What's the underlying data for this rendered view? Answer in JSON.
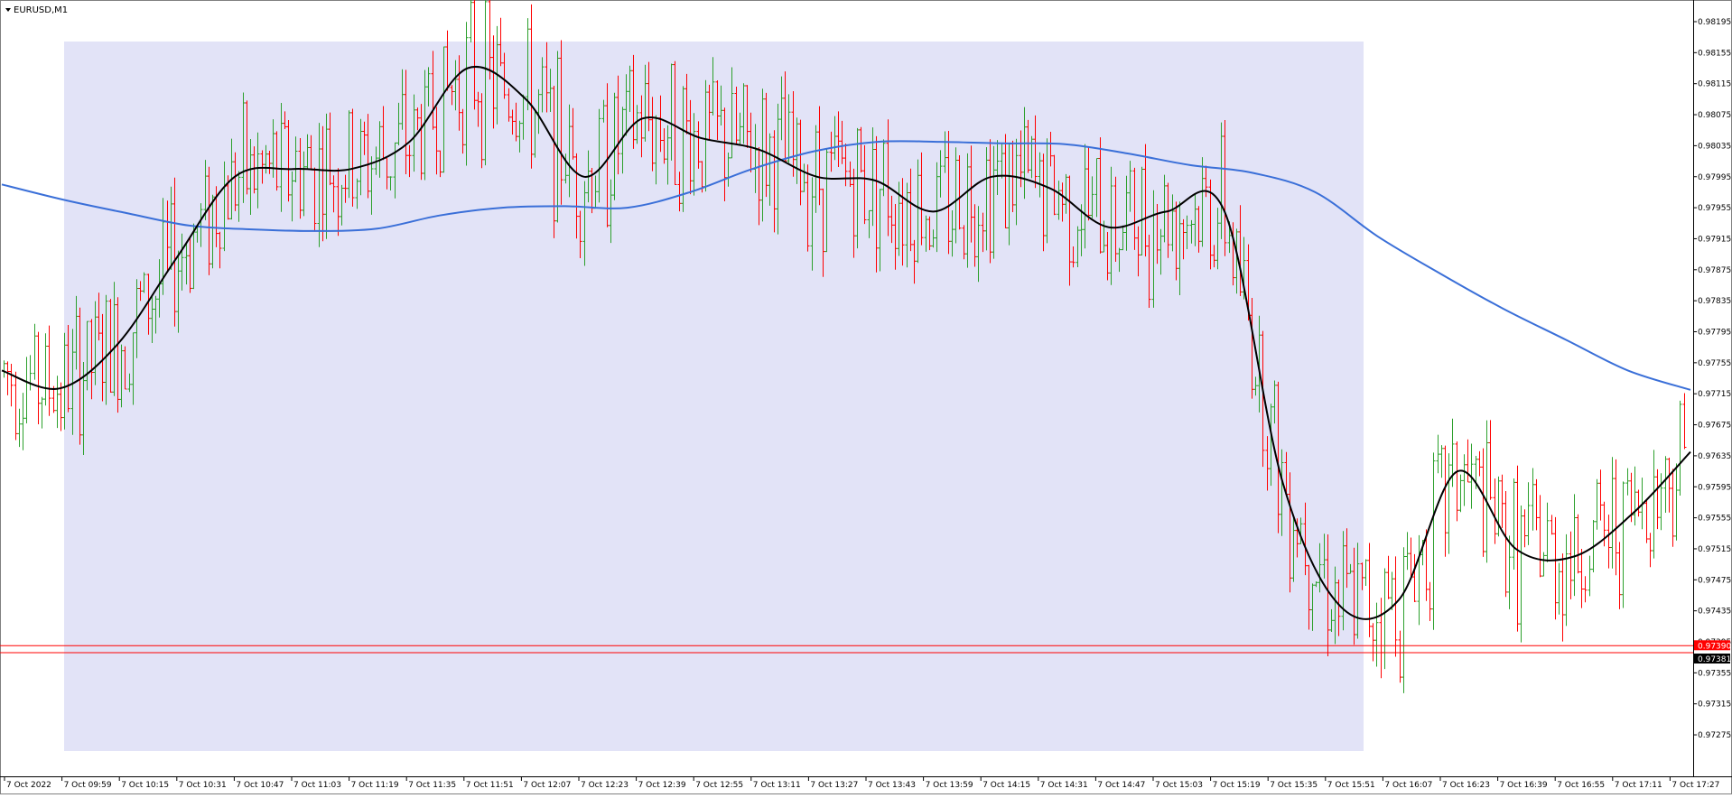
{
  "window": {
    "symbol_label": "EURUSD,M1",
    "menu_arrow_icon": "triangle-down-icon"
  },
  "colors": {
    "background": "#ffffff",
    "selection_band": "#e2e3f7",
    "bull_candle": "#2ca02c",
    "bear_candle": "#ff0000",
    "ma_fast": "#000000",
    "ma_slow": "#3a6fd8",
    "price_line": "#ff0000",
    "bid_label_bg": "#ff0000",
    "ask_label_bg": "#000000"
  },
  "chart_data": {
    "type": "line",
    "title": "EURUSD,M1",
    "y_axis_ticks": [
      "0.98195",
      "0.98155",
      "0.98115",
      "0.98075",
      "0.98035",
      "0.97995",
      "0.97955",
      "0.97915",
      "0.97875",
      "0.97835",
      "0.97795",
      "0.97755",
      "0.97715",
      "0.97675",
      "0.97635",
      "0.97595",
      "0.97555",
      "0.97515",
      "0.97475",
      "0.97435",
      "0.97395",
      "0.97355",
      "0.97315",
      "0.97275"
    ],
    "y_range": [
      0.97255,
      0.98215
    ],
    "x_axis_ticks": [
      "7 Oct 2022",
      "7 Oct 09:59",
      "7 Oct 10:15",
      "7 Oct 10:31",
      "7 Oct 10:47",
      "7 Oct 11:03",
      "7 Oct 11:19",
      "7 Oct 11:35",
      "7 Oct 11:51",
      "7 Oct 12:07",
      "7 Oct 12:23",
      "7 Oct 12:39",
      "7 Oct 12:55",
      "7 Oct 13:11",
      "7 Oct 13:27",
      "7 Oct 13:43",
      "7 Oct 13:59",
      "7 Oct 14:15",
      "7 Oct 14:31",
      "7 Oct 14:47",
      "7 Oct 15:03",
      "7 Oct 15:19",
      "7 Oct 15:35",
      "7 Oct 15:51",
      "7 Oct 16:07",
      "7 Oct 16:23",
      "7 Oct 16:39",
      "7 Oct 16:55",
      "7 Oct 17:11",
      "7 Oct 17:27"
    ],
    "current_price_labels": {
      "bid": "0.97390",
      "ask": "0.97381"
    },
    "price_lines": [
      0.9739,
      0.97381
    ],
    "selection_range": {
      "from": "7 Oct 09:59",
      "to": "7 Oct 15:51"
    },
    "series": [
      {
        "name": "",
        "style": "ma_slow",
        "values": [
          0.97985,
          0.97965,
          0.97948,
          0.97932,
          0.97927,
          0.97925,
          0.97928,
          0.97945,
          0.97955,
          0.97957,
          0.97955,
          0.97975,
          0.98005,
          0.98028,
          0.9804,
          0.9804,
          0.98038,
          0.98037,
          0.98025,
          0.9801,
          0.98,
          0.97975,
          0.97918,
          0.9787,
          0.97825,
          0.97785,
          0.97745,
          0.9772
        ]
      },
      {
        "name": "",
        "style": "ma_fast",
        "values": [
          0.97745,
          0.97722,
          0.9778,
          0.9789,
          0.97995,
          0.98005,
          0.98005,
          0.9804,
          0.98135,
          0.98095,
          0.97995,
          0.9807,
          0.98045,
          0.9803,
          0.97995,
          0.9799,
          0.9795,
          0.97995,
          0.9798,
          0.9793,
          0.9795,
          0.9795,
          0.976,
          0.9744,
          0.9745,
          0.97615,
          0.97515,
          0.97505,
          0.9756,
          0.9764
        ]
      }
    ]
  }
}
